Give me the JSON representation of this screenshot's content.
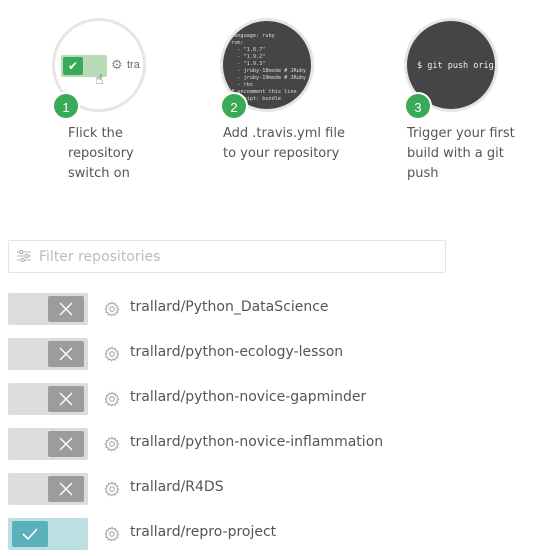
{
  "steps": [
    {
      "number": "1",
      "text": [
        "Flick the",
        "repository",
        "switch on"
      ],
      "preview_label": "tra"
    },
    {
      "number": "2",
      "text": [
        "Add .travis.yml file",
        "to your repository"
      ],
      "code": "language: ruby\nrvm:\n  - \"1.8.7\"\n  - \"1.9.2\"\n  - \"1.9.3\"\n  - jruby-18mode # JRuby\n  - jruby-19mode # JRuby\n  - rbx\n# uncomment this line\n  script: bundle"
    },
    {
      "number": "3",
      "text": [
        "Trigger your first",
        "build with a git",
        "push"
      ],
      "command": "$ git push origin"
    }
  ],
  "filter": {
    "placeholder": "Filter repositories",
    "value": ""
  },
  "repos": [
    {
      "name": "trallard/Python_DataScience",
      "active": false
    },
    {
      "name": "trallard/python-ecology-lesson",
      "active": false
    },
    {
      "name": "trallard/python-novice-gapminder",
      "active": false
    },
    {
      "name": "trallard/python-novice-inflammation",
      "active": false
    },
    {
      "name": "trallard/R4DS",
      "active": false
    },
    {
      "name": "trallard/repro-project",
      "active": true
    }
  ],
  "colors": {
    "step_badge": "#39aa56",
    "toggle_off": "#9c9c9c",
    "toggle_on": "#5ab1bc"
  }
}
